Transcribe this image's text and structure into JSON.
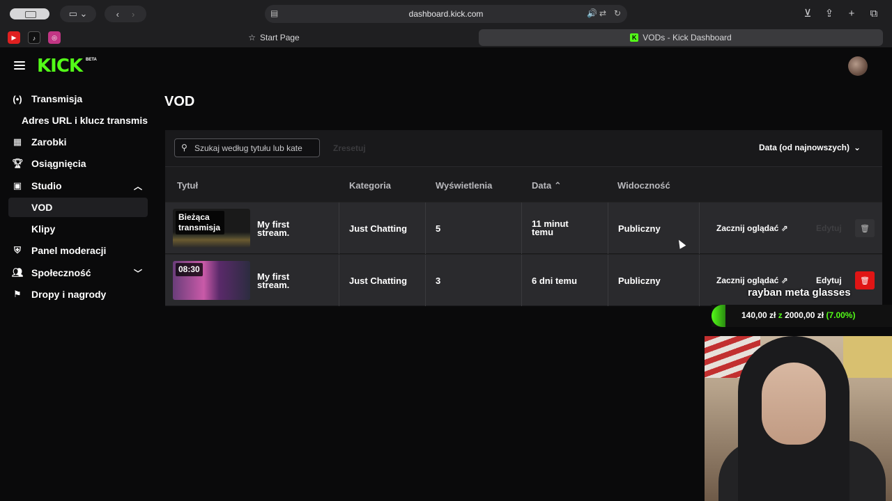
{
  "browser": {
    "url": "dashboard.kick.com",
    "tabs": [
      {
        "label": "Start Page"
      },
      {
        "label": "VODs - Kick Dashboard"
      }
    ]
  },
  "app": {
    "logo": "KICK",
    "logo_badge": "BETA"
  },
  "sidebar": {
    "items": [
      {
        "label": "Transmisja",
        "icon": "broadcast-icon"
      },
      {
        "label": "Adres URL i klucz transmis"
      },
      {
        "label": "Zarobki",
        "icon": "earnings-icon"
      },
      {
        "label": "Osiągnięcia",
        "icon": "trophy-icon"
      },
      {
        "label": "Studio",
        "icon": "studio-icon"
      },
      {
        "label": "VOD"
      },
      {
        "label": "Klipy"
      },
      {
        "label": "Panel moderacji",
        "icon": "shield-icon"
      },
      {
        "label": "Społeczność",
        "icon": "community-icon"
      },
      {
        "label": "Dropy i nagrody",
        "icon": "gift-icon"
      }
    ]
  },
  "main": {
    "title": "VOD",
    "search_placeholder": "Szukaj według tytułu lub kate",
    "reset_label": "Zresetuj",
    "sort_label": "Data (od najnowszych)",
    "columns": [
      "Tytuł",
      "Kategoria",
      "Wyświetlenia",
      "Data",
      "Widoczność"
    ],
    "rows": [
      {
        "thumb_label": "Bieżąca transmisja",
        "title": "My first stream.",
        "category": "Just Chatting",
        "views": "5",
        "date": "11 minut temu",
        "visibility": "Publiczny",
        "watch": "Zacznij oglądać",
        "edit": "Edytuj"
      },
      {
        "thumb_label": "08:30",
        "title": "My first stream.",
        "category": "Just Chatting",
        "views": "3",
        "date": "6 dni temu",
        "visibility": "Publiczny",
        "watch": "Zacznij oglądać",
        "edit": "Edytuj"
      }
    ]
  },
  "overlay": {
    "goal_title": "rayban meta glasses",
    "amount": "140,00 zł",
    "sep": "z",
    "target": "2000,00 zł",
    "percent": "(7.00%)"
  },
  "colors": {
    "accent": "#53fc18",
    "danger": "#e01515"
  }
}
